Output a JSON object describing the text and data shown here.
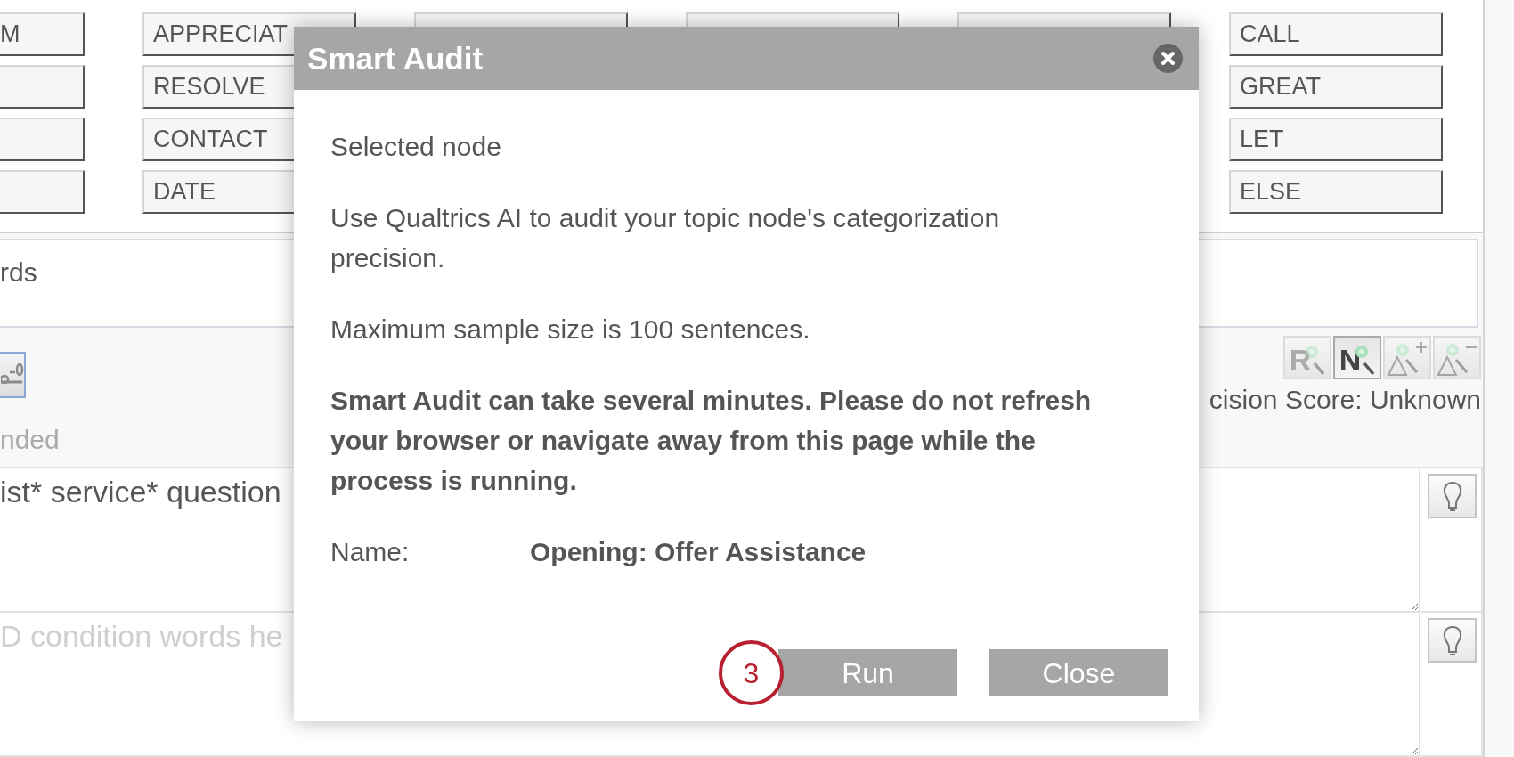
{
  "word_grid": {
    "columns": [
      {
        "buttons": [
          {
            "kind": "word",
            "word": "M"
          },
          {
            "kind": "blank"
          },
          {
            "kind": "blank"
          },
          {
            "kind": "blank"
          }
        ]
      },
      {
        "buttons": [
          {
            "kind": "word",
            "word": "APPRECIAT"
          },
          {
            "kind": "word",
            "word": "RESOLVE"
          },
          {
            "kind": "word",
            "word": "CONTACT"
          },
          {
            "kind": "word",
            "word": "DATE"
          }
        ]
      },
      {
        "buttons": [
          {
            "kind": "blank"
          }
        ]
      },
      {
        "buttons": [
          {
            "kind": "blank"
          }
        ]
      },
      {
        "buttons": [
          {
            "kind": "blank"
          }
        ]
      },
      {
        "buttons": [
          {
            "kind": "word",
            "word": "CALL"
          },
          {
            "kind": "word",
            "word": "GREAT"
          },
          {
            "kind": "word",
            "word": "LET"
          },
          {
            "kind": "word",
            "word": "ELSE"
          }
        ]
      }
    ]
  },
  "words_panel": {
    "text": "rds"
  },
  "toolbar": {
    "hint": "nded",
    "view_buttons": [
      {
        "kind": "letter",
        "glyph": "R",
        "selected": false
      },
      {
        "kind": "letter",
        "glyph": "N",
        "selected": true
      },
      {
        "kind": "plus",
        "selected": false
      },
      {
        "kind": "minus",
        "selected": false
      }
    ],
    "precision": "cision Score: Unknown"
  },
  "condition_rows": [
    {
      "value": "ist* service* question"
    },
    {
      "placeholder": "D condition words he"
    }
  ],
  "dialog": {
    "title": "Smart Audit",
    "paragraphs": [
      {
        "kind": "note",
        "text": "Selected node"
      },
      {
        "kind": "note",
        "text": "Use Qualtrics AI to audit your topic node's categorization precision."
      },
      {
        "kind": "note",
        "text": "Maximum sample size is 100 sentences."
      },
      {
        "kind": "warning",
        "text": "Smart Audit can take several minutes. Please do not refresh your browser or navigate away from this page while the process is running."
      }
    ],
    "name_field": {
      "label": "Name:",
      "value": "Opening: Offer Assistance"
    },
    "buttons": [
      {
        "label": "Run",
        "callout": "3"
      },
      {
        "label": "Close"
      }
    ]
  }
}
